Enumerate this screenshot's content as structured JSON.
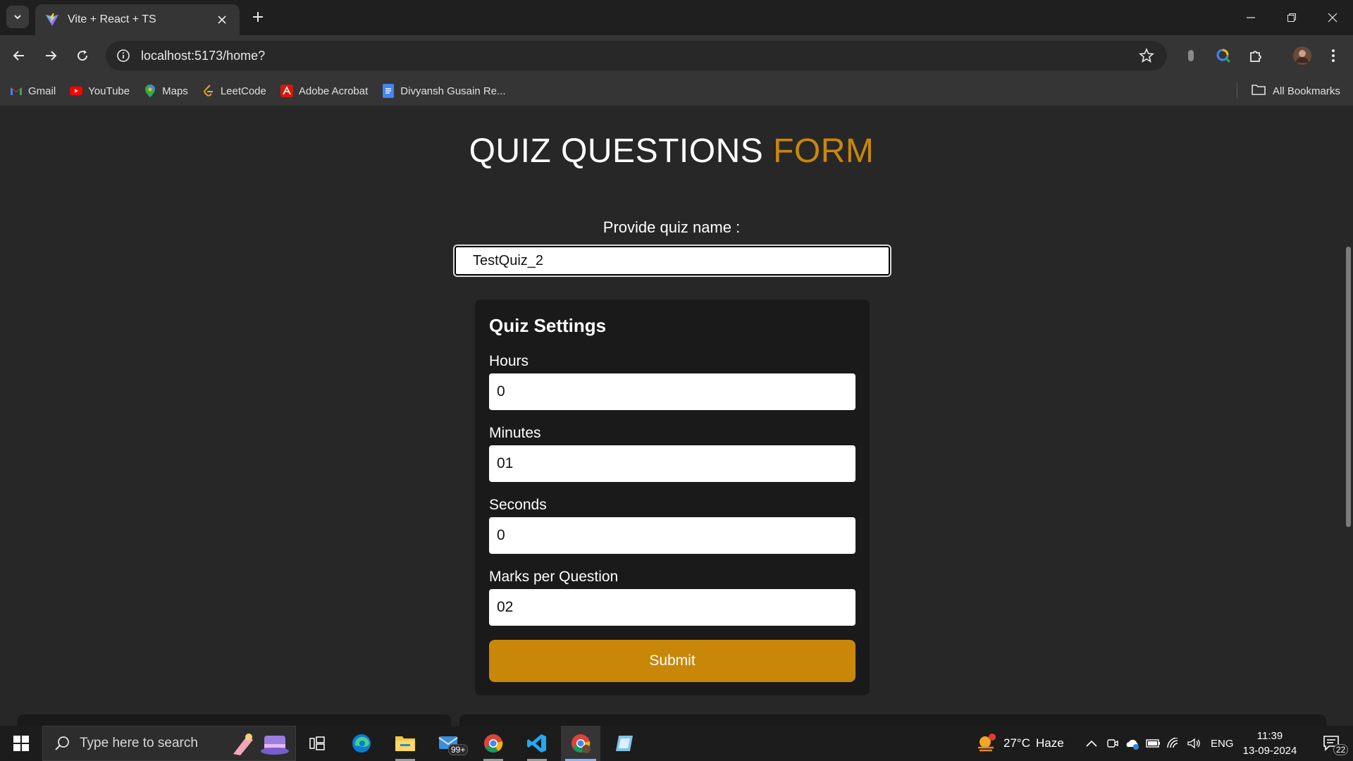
{
  "browser": {
    "tab_title": "Vite + React + TS",
    "url": "localhost:5173/home?",
    "bookmarks": [
      {
        "label": "Gmail",
        "icon": "gmail-icon"
      },
      {
        "label": "YouTube",
        "icon": "youtube-icon"
      },
      {
        "label": "Maps",
        "icon": "maps-icon"
      },
      {
        "label": "LeetCode",
        "icon": "leetcode-icon"
      },
      {
        "label": "Adobe Acrobat",
        "icon": "acrobat-icon"
      },
      {
        "label": "Divyansh Gusain Re...",
        "icon": "docs-icon"
      }
    ],
    "all_bookmarks_label": "All Bookmarks"
  },
  "page": {
    "title_main": "QUIZ QUESTIONS",
    "title_accent": "FORM",
    "quiz_name_label": "Provide quiz name :",
    "quiz_name_value": "TestQuiz_2",
    "settings": {
      "heading": "Quiz Settings",
      "fields": [
        {
          "label": "Hours",
          "value": "0"
        },
        {
          "label": "Minutes",
          "value": "01"
        },
        {
          "label": "Seconds",
          "value": "0"
        },
        {
          "label": "Marks per Question",
          "value": "02"
        }
      ],
      "submit_label": "Submit"
    }
  },
  "taskbar": {
    "search_placeholder": "Type here to search",
    "mail_badge": "99+",
    "weather_temp": "27°C",
    "weather_desc": "Haze",
    "language": "ENG",
    "time": "11:39",
    "date": "13-09-2024",
    "notification_count": "22"
  },
  "colors": {
    "accent": "#c9870a",
    "page_bg": "#272727",
    "card_bg": "#1a1a1a"
  }
}
